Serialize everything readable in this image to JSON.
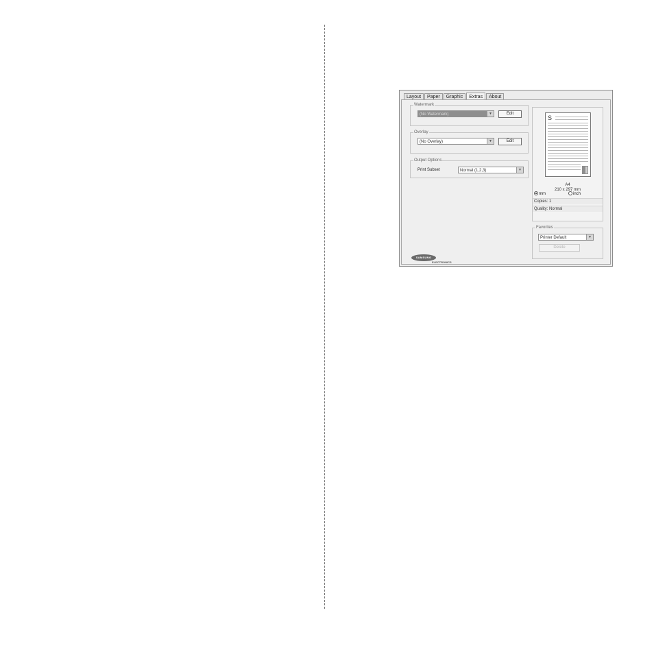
{
  "tabs": [
    "Layout",
    "Paper",
    "Graphic",
    "Extras",
    "About"
  ],
  "active_tab": "Extras",
  "watermark": {
    "legend": "Watermark",
    "selected": "(No Watermark)",
    "edit_label": "Edit"
  },
  "overlay": {
    "legend": "Overlay",
    "selected": "(No Overlay)",
    "edit_label": "Edit"
  },
  "output_options": {
    "legend": "Output Options",
    "print_subset_label": "Print Subset",
    "print_subset_value": "Normal (1,2,3)"
  },
  "preview": {
    "page_letter": "S",
    "paper_name": "A4",
    "paper_size": "210 x 297 mm",
    "unit_mm": "mm",
    "unit_inch": "inch",
    "selected_unit": "mm",
    "copies": "Copies: 1",
    "quality": "Quality: Normal"
  },
  "favorites": {
    "legend": "Favorites",
    "selected": "Printer Default",
    "delete_label": "Delete"
  },
  "logo": {
    "brand": "SAMSUNG",
    "sub": "ELECTRONICS"
  }
}
